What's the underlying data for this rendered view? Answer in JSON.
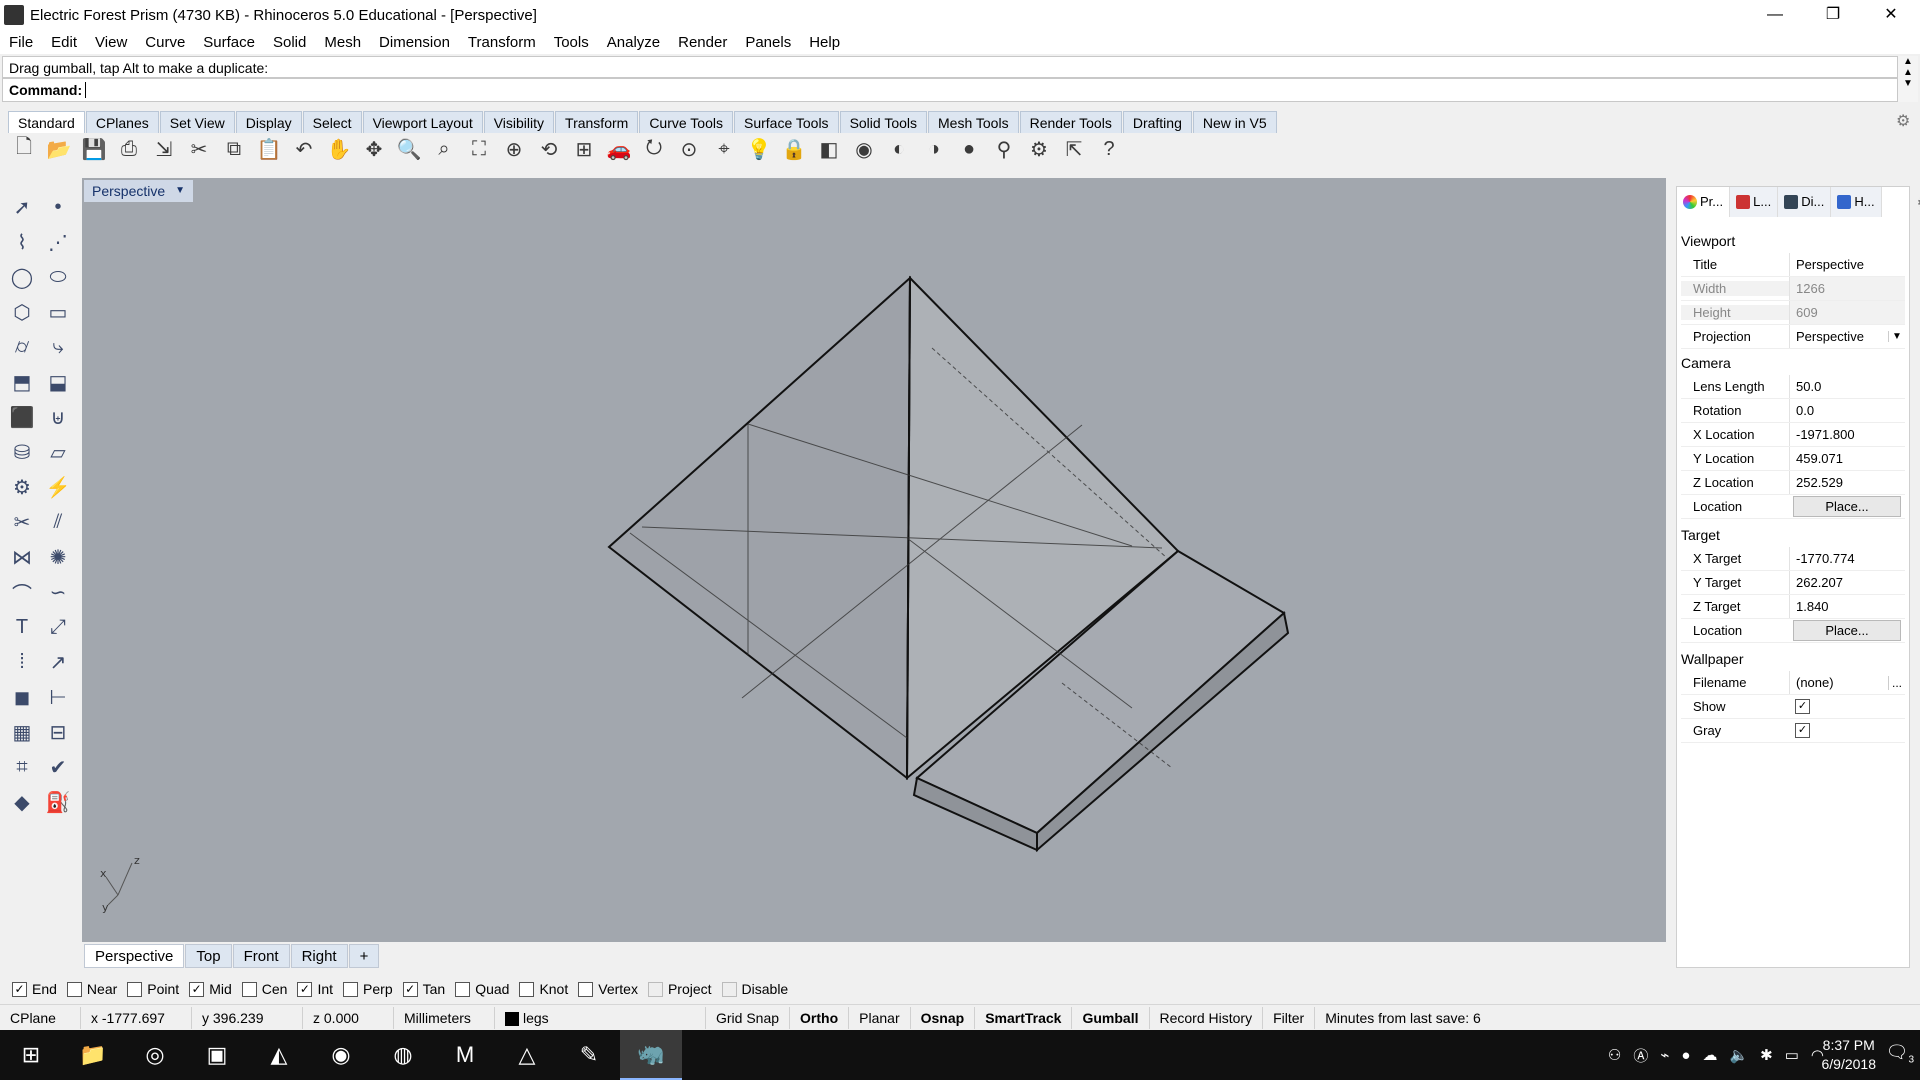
{
  "window": {
    "title": "Electric Forest Prism (4730 KB) - Rhinoceros 5.0 Educational - [Perspective]",
    "minimize": "—",
    "restore": "❐",
    "close": "✕"
  },
  "menu": [
    "File",
    "Edit",
    "View",
    "Curve",
    "Surface",
    "Solid",
    "Mesh",
    "Dimension",
    "Transform",
    "Tools",
    "Analyze",
    "Render",
    "Panels",
    "Help"
  ],
  "command": {
    "history": "Drag gumball, tap Alt to make a duplicate:",
    "prompt": "Command:",
    "value": ""
  },
  "toolbar_tabs": [
    "Standard",
    "CPlanes",
    "Set View",
    "Display",
    "Select",
    "Viewport Layout",
    "Visibility",
    "Transform",
    "Curve Tools",
    "Surface Tools",
    "Solid Tools",
    "Mesh Tools",
    "Render Tools",
    "Drafting",
    "New in V5"
  ],
  "active_toolbar_tab": "Standard",
  "standard_icons": [
    "new-file",
    "open-file",
    "save",
    "print",
    "import",
    "cut",
    "copy",
    "paste",
    "undo",
    "pan",
    "move-view",
    "zoom-window",
    "zoom-dynamic",
    "zoom-extents",
    "zoom-selected",
    "rotate-view",
    "four-viewports",
    "car",
    "rotate-camera",
    "properties",
    "object-snap",
    "light",
    "lock",
    "layer",
    "color-wheel",
    "render-sphere",
    "shaded-sphere",
    "blue-sphere",
    "filter",
    "settings",
    "transform",
    "help"
  ],
  "left_tools": [
    "select-arrow",
    "point",
    "polyline",
    "control-points",
    "circle",
    "ellipse",
    "polygon",
    "rectangle",
    "cylinder-tool",
    "fillet-curve",
    "extrude",
    "surface-edit",
    "box",
    "boolean-union",
    "cylinder",
    "plane-surface",
    "gear",
    "analyze",
    "trim",
    "split",
    "join",
    "explode",
    "fillet",
    "blend",
    "text",
    "scale",
    "array",
    "orient",
    "solid-box",
    "dimension",
    "grid-array",
    "layout",
    "mesh",
    "check",
    "rhino-solid",
    "render-bucket"
  ],
  "viewport": {
    "title": "Perspective",
    "axis_x": "x",
    "axis_y": "y",
    "axis_z": "z"
  },
  "viewport_tabs": [
    "Perspective",
    "Top",
    "Front",
    "Right",
    "+"
  ],
  "active_viewport_tab": "Perspective",
  "osnaps": [
    {
      "label": "End",
      "checked": true
    },
    {
      "label": "Near",
      "checked": false
    },
    {
      "label": "Point",
      "checked": false
    },
    {
      "label": "Mid",
      "checked": true
    },
    {
      "label": "Cen",
      "checked": false
    },
    {
      "label": "Int",
      "checked": true
    },
    {
      "label": "Perp",
      "checked": false
    },
    {
      "label": "Tan",
      "checked": true
    },
    {
      "label": "Quad",
      "checked": false
    },
    {
      "label": "Knot",
      "checked": false
    },
    {
      "label": "Vertex",
      "checked": false
    },
    {
      "label": "Project",
      "checked": false,
      "disabled": true
    },
    {
      "label": "Disable",
      "checked": false,
      "disabled": true
    }
  ],
  "status": {
    "cplane": "CPlane",
    "x": "x -1777.697",
    "y": "y 396.239",
    "z": "z 0.000",
    "units": "Millimeters",
    "layer": "legs",
    "grid_snap": "Grid Snap",
    "ortho": "Ortho",
    "planar": "Planar",
    "osnap": "Osnap",
    "smarttrack": "SmartTrack",
    "gumball": "Gumball",
    "record_history": "Record History",
    "filter": "Filter",
    "save_info": "Minutes from last save: 6"
  },
  "panel": {
    "tabs": [
      "Pr...",
      "L...",
      "Di...",
      "H..."
    ],
    "viewport_section": "Viewport",
    "title_label": "Title",
    "title_value": "Perspective",
    "width_label": "Width",
    "width_value": "1266",
    "height_label": "Height",
    "height_value": "609",
    "projection_label": "Projection",
    "projection_value": "Perspective",
    "camera_section": "Camera",
    "lens_label": "Lens Length",
    "lens_value": "50.0",
    "rotation_label": "Rotation",
    "rotation_value": "0.0",
    "xloc_label": "X Location",
    "xloc_value": "-1971.800",
    "yloc_label": "Y Location",
    "yloc_value": "459.071",
    "zloc_label": "Z Location",
    "zloc_value": "252.529",
    "location_label": "Location",
    "place_button": "Place...",
    "target_section": "Target",
    "xt_label": "X Target",
    "xt_value": "-1770.774",
    "yt_label": "Y Target",
    "yt_value": "262.207",
    "zt_label": "Z Target",
    "zt_value": "1.840",
    "tlocation_label": "Location",
    "tplace_button": "Place...",
    "wallpaper_section": "Wallpaper",
    "filename_label": "Filename",
    "filename_value": "(none)",
    "browse_button": "...",
    "show_label": "Show",
    "show_checked": true,
    "gray_label": "Gray",
    "gray_checked": true
  },
  "taskbar": {
    "icons": [
      "start",
      "file-explorer",
      "chrome",
      "live",
      "unity",
      "spotify",
      "firefox",
      "maya",
      "drive",
      "paint",
      "rhino"
    ],
    "time": "8:37 PM",
    "date": "6/9/2018",
    "notifications": "3"
  }
}
